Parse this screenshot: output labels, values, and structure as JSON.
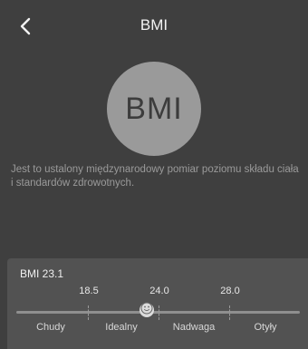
{
  "header": {
    "title": "BMI",
    "back_icon": "chevron-left-icon"
  },
  "logo": {
    "text": "BMI"
  },
  "description": "Jest to ustalony międzynarodowy pomiar poziomu składu ciała i standardów zdrowotnych.",
  "scale": {
    "current_label": "BMI 23.1",
    "current_value": 23.1,
    "thresholds": [
      "18.5",
      "24.0",
      "28.0"
    ],
    "categories": [
      "Chudy",
      "Idealny",
      "Nadwaga",
      "Otyły"
    ],
    "marker_icon": "smiley-face-icon"
  }
}
